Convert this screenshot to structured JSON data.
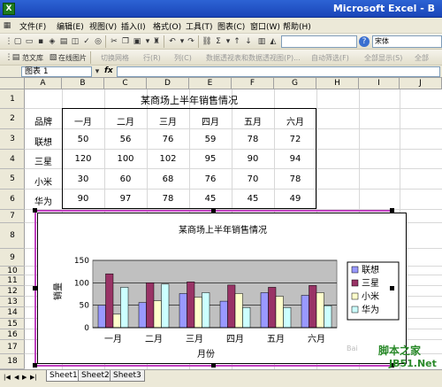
{
  "window": {
    "title": "Microsoft Excel - B"
  },
  "menu": [
    "文件(F)",
    "编辑(E)",
    "视图(V)",
    "插入(I)",
    "格式(O)",
    "工具(T)",
    "图表(C)",
    "窗口(W)",
    "帮助(H)"
  ],
  "toolbar": {
    "font_name": "宋体",
    "zoom_help": "?",
    "items_row2": [
      "范文库",
      "在线图片",
      "切换网格",
      "行(R)",
      "列(C)",
      "数据透视表和数据透视图(P)...",
      "自动筛选(F)",
      "全部显示(S)",
      "全部"
    ]
  },
  "formula_bar": {
    "name_box": "图表 1",
    "fx": "fx",
    "content": ""
  },
  "columns": [
    "A",
    "B",
    "C",
    "D",
    "E",
    "F",
    "G",
    "H",
    "I",
    "J"
  ],
  "rows": [
    "1",
    "2",
    "3",
    "4",
    "5",
    "6",
    "7",
    "8",
    "9",
    "10",
    "11",
    "12",
    "13",
    "14",
    "15",
    "16",
    "17",
    "18"
  ],
  "table": {
    "title": "某商场上半年销售情况",
    "headers": [
      "品牌",
      "一月",
      "二月",
      "三月",
      "四月",
      "五月",
      "六月"
    ],
    "rows": [
      [
        "联想",
        "50",
        "56",
        "76",
        "59",
        "78",
        "72"
      ],
      [
        "三星",
        "120",
        "100",
        "102",
        "95",
        "90",
        "94"
      ],
      [
        "小米",
        "30",
        "60",
        "68",
        "76",
        "70",
        "78"
      ],
      [
        "华为",
        "90",
        "97",
        "78",
        "45",
        "45",
        "49"
      ]
    ]
  },
  "chart_data": {
    "type": "bar",
    "title": "某商场上半年销售情况",
    "xlabel": "月份",
    "ylabel": "销量",
    "categories": [
      "一月",
      "二月",
      "三月",
      "四月",
      "五月",
      "六月"
    ],
    "series": [
      {
        "name": "联想",
        "values": [
          50,
          56,
          76,
          59,
          78,
          72
        ],
        "color": "#9999ff"
      },
      {
        "name": "三星",
        "values": [
          120,
          100,
          102,
          95,
          90,
          94
        ],
        "color": "#993366"
      },
      {
        "name": "小米",
        "values": [
          30,
          60,
          68,
          76,
          70,
          78
        ],
        "color": "#ffffcc"
      },
      {
        "name": "华为",
        "values": [
          90,
          97,
          78,
          45,
          45,
          49
        ],
        "color": "#ccffff"
      }
    ],
    "ylim": [
      0,
      150
    ],
    "yticks": [
      "0",
      "50",
      "100",
      "150"
    ],
    "plot_bg": "#c0c0c0",
    "legend": "right"
  },
  "sheets": [
    "Sheet1",
    "Sheet2",
    "Sheet3"
  ],
  "watermark": {
    "line1": "脚本之家",
    "line2": "JB51.Net",
    "faint": "Bai"
  }
}
